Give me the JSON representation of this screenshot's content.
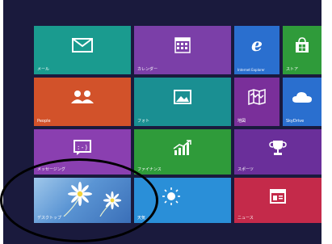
{
  "start_screen": {
    "background": "#1a1a3d",
    "tiles": [
      {
        "id": "mail",
        "label": "メール",
        "icon": "envelope-icon",
        "color": "#1a9b8f"
      },
      {
        "id": "calendar",
        "label": "カレンダー",
        "icon": "calendar-icon",
        "color": "#7b3fa8"
      },
      {
        "id": "ie",
        "label": "Internet Explorer",
        "icon": "internet-explorer-icon",
        "color": "#2a6fcf"
      },
      {
        "id": "store",
        "label": "ストア",
        "icon": "store-bag-icon",
        "color": "#2f9b3a"
      },
      {
        "id": "people",
        "label": "People",
        "icon": "people-icon",
        "color": "#d2522a"
      },
      {
        "id": "photos",
        "label": "フォト",
        "icon": "photo-icon",
        "color": "#1a8f92"
      },
      {
        "id": "maps",
        "label": "地図",
        "icon": "map-icon",
        "color": "#7a2f9a"
      },
      {
        "id": "skydrive",
        "label": "SkyDrive",
        "icon": "cloud-icon",
        "color": "#2a6fcf"
      },
      {
        "id": "messaging",
        "label": "メッセージング",
        "icon": "smiley-bubble-icon",
        "color": "#8a3fb0"
      },
      {
        "id": "finance",
        "label": "ファイナンス",
        "icon": "chart-up-icon",
        "color": "#2f9b3a"
      },
      {
        "id": "sports",
        "label": "スポーツ",
        "icon": "trophy-icon",
        "color": "#6a2f9a"
      },
      {
        "id": "desktop",
        "label": "デスクトップ",
        "icon": "desktop-wallpaper-icon",
        "color": "#3a7fd0"
      },
      {
        "id": "weather",
        "label": "天気",
        "icon": "sun-icon",
        "color": "#2a8fd8"
      },
      {
        "id": "news",
        "label": "ニュース",
        "icon": "news-icon",
        "color": "#c42a4a"
      }
    ]
  },
  "annotation": {
    "type": "ellipse",
    "color": "#000000",
    "target": "desktop"
  }
}
